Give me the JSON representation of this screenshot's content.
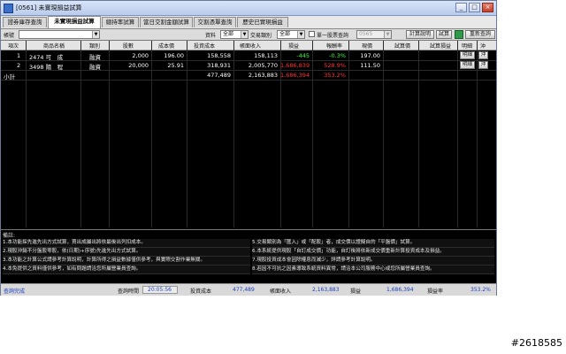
{
  "window": {
    "title": "[0561] 未實現損益試算",
    "min_label": "_",
    "max_label": "□",
    "close_label": "×"
  },
  "tabs": [
    "證券庫存查詢",
    "未實現損益試算",
    "總持率試算",
    "當日交割金額試算",
    "交割憑單查詢",
    "歷史已實現損益"
  ],
  "filters": {
    "account_label": "帳號",
    "account_value": "",
    "source_label": "資料",
    "source_value": "全部",
    "trade_type_label": "交易類別",
    "trade_type_value": "全部",
    "single_stock_label": "單一股票查詢",
    "single_stock_value": "0565",
    "calc_button": "計算說明",
    "trial_button": "試算",
    "refresh_button": "重新查詢"
  },
  "table": {
    "headers": [
      "項次",
      "商品名稱",
      "類別",
      "股數",
      "成本價",
      "投資成本",
      "帳面收入",
      "損益",
      "報酬率",
      "現價",
      "試算價",
      "試算損益",
      "明細",
      "沖"
    ],
    "rows": [
      {
        "no": "1",
        "name": "2474 可　成",
        "type": "融資",
        "shares": "2,000",
        "cost_price": "196.00",
        "invest_cost": "158,558",
        "book_income": "158,113",
        "pnl": "-445",
        "ret": "-0.3%",
        "price": "197.00",
        "detail": "明細",
        "offset": "沖"
      },
      {
        "no": "2",
        "name": "3498 陽　程",
        "type": "融資",
        "shares": "20,000",
        "cost_price": "25.91",
        "invest_cost": "318,931",
        "book_income": "2,005,770",
        "pnl": "1,686,839",
        "ret": "528.9%",
        "price": "111.50",
        "detail": "明細",
        "offset": "沖"
      }
    ],
    "subtotal": {
      "label": "小計",
      "invest_cost": "477,489",
      "book_income": "2,163,883",
      "pnl": "1,686,394",
      "ret": "353.2%"
    }
  },
  "notes": {
    "title": "備註:",
    "items": [
      "1.本功能採先進先出方式試算，買出成屬出將依最後出列扣成本。",
      "2.現股沖銷不分盤股零股，依(日期)+序號)先進先出方式試算。",
      "3.本功能之計算公式請參考計算說明，計算所得之損益數據僅供參考，與實際交割作業無關。",
      "4.本免提供之資料僅供參考，如有問題請洽您所屬營業員查詢。",
      "5.交易類別為「匯入」或「配股」者，成交價以證擬自的「平盤價」試算。",
      "6.本系統提供現股「自訂成交價」功能，自訂後將依新成交價重新計算投資成本及損益。",
      "7.現股投資成本會因除權息而減少，詳請參考計算說明。",
      "8.若因不可抗之因素導致系統資料異常，請洽本公司服務中心或您所屬營業員查詢。"
    ]
  },
  "status": {
    "message": "查詢完成",
    "query_time_label": "查詢時間",
    "query_time": "20:05:56",
    "invest_cost_label": "投資成本",
    "invest_cost": "477,489",
    "book_income_label": "帳面收入",
    "book_income": "2,163,883",
    "pnl_label": "損益",
    "pnl": "1,686,394",
    "ret_label": "損益率",
    "ret": "353.2%"
  },
  "watermark": "#2618585",
  "colors": {
    "positive": "#ff3030",
    "negative": "#33ff33",
    "background": "#000000"
  }
}
